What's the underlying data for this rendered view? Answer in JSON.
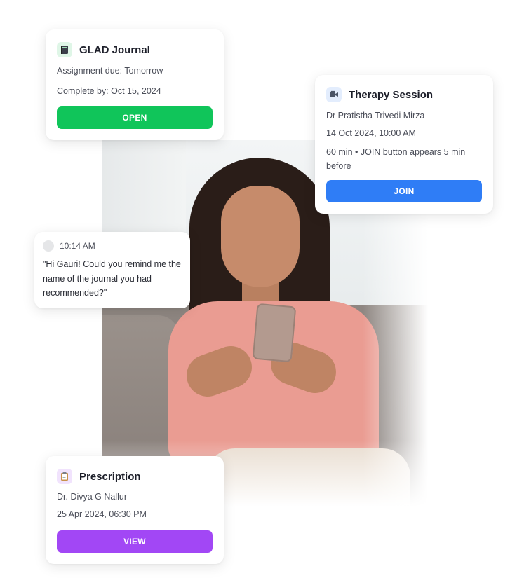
{
  "journal_card": {
    "title": "GLAD Journal",
    "icon": "journal-icon",
    "assignment": "Assignment due: Tomorrow",
    "complete_by": "Complete by: Oct 15, 2024",
    "button_label": "OPEN",
    "button_color": "#10c55a"
  },
  "therapy_card": {
    "title": "Therapy Session",
    "icon": "video-camera-icon",
    "doctor": "Dr Pratistha Trivedi Mirza",
    "datetime": "14 Oct 2024, 10:00 AM",
    "note": "60 min • JOIN button appears 5 min before",
    "button_label": "JOIN",
    "button_color": "#2f7df6"
  },
  "chat_card": {
    "time": "10:14 AM",
    "message": "\"Hi Gauri! Could you remind me the name of the journal you had recommended?\""
  },
  "prescription_card": {
    "title": "Prescription",
    "icon": "clipboard-icon",
    "doctor": "Dr. Divya G Nallur",
    "datetime": "25 Apr 2024, 06:30 PM",
    "button_label": "VIEW",
    "button_color": "#a247f5"
  }
}
